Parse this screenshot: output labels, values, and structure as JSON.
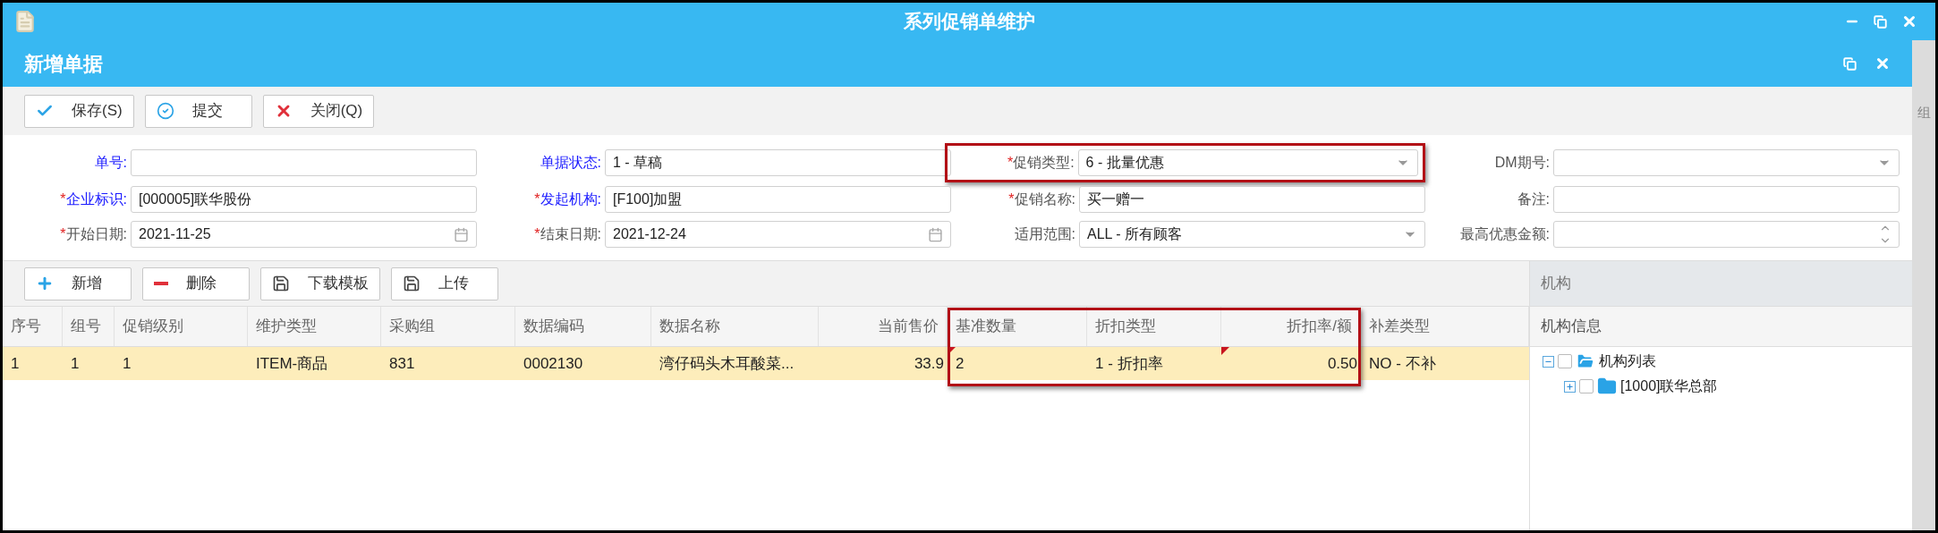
{
  "window": {
    "title": "系列促销单维护"
  },
  "subwindow": {
    "title": "新增单据"
  },
  "toolbar": [
    {
      "label": "保存(S)",
      "kind": "save"
    },
    {
      "label": "提交",
      "kind": "submit"
    },
    {
      "label": "关闭(Q)",
      "kind": "close"
    }
  ],
  "form": [
    {
      "label": "单号:",
      "required": false,
      "color": "#1a1aff",
      "kind": "text",
      "highlighted": false
    },
    {
      "label": "单据状态:",
      "required": false,
      "color": "#1a1aff",
      "value": "1 - 草稿",
      "kind": "text",
      "highlighted": false
    },
    {
      "label": "促销类型:",
      "required": true,
      "color": "#555555",
      "value": "6 - 批量优惠",
      "kind": "select",
      "highlighted": true
    },
    {
      "label": "DM期号:",
      "required": false,
      "color": "#555555",
      "kind": "select",
      "highlighted": false
    },
    {
      "label": "企业标识:",
      "required": true,
      "color": "#1a1aff",
      "value": "[000005]联华股份",
      "kind": "text",
      "highlighted": false
    },
    {
      "label": "发起机构:",
      "required": true,
      "color": "#1a1aff",
      "value": "[F100]加盟",
      "kind": "text",
      "highlighted": false
    },
    {
      "label": "促销名称:",
      "required": true,
      "color": "#555555",
      "value": "买一赠一",
      "kind": "text",
      "highlighted": false
    },
    {
      "label": "备注:",
      "required": false,
      "color": "#555555",
      "kind": "text",
      "highlighted": false
    },
    {
      "label": "开始日期:",
      "required": true,
      "color": "#555555",
      "value": "2021-11-25",
      "kind": "date",
      "highlighted": false
    },
    {
      "label": "结束日期:",
      "required": true,
      "color": "#555555",
      "value": "2021-12-24",
      "kind": "date",
      "highlighted": false
    },
    {
      "label": "适用范围:",
      "required": false,
      "color": "#555555",
      "value": "ALL - 所有顾客",
      "kind": "select",
      "highlighted": false
    },
    {
      "label": "最高优惠金额:",
      "required": false,
      "color": "#555555",
      "kind": "spinner",
      "highlighted": false
    }
  ],
  "required_mark": "*",
  "grid_toolbar": [
    {
      "label": "新增",
      "kind": "add"
    },
    {
      "label": "删除",
      "kind": "delete"
    },
    {
      "label": "下载模板",
      "kind": "save"
    },
    {
      "label": "上传",
      "kind": "save"
    }
  ],
  "table": {
    "columns": [
      {
        "label": "序号",
        "kind": "text",
        "highlighted": false
      },
      {
        "label": "组号",
        "kind": "text",
        "highlighted": false
      },
      {
        "label": "促销级别",
        "kind": "text",
        "highlighted": false
      },
      {
        "label": "维护类型",
        "kind": "text",
        "highlighted": false
      },
      {
        "label": "采购组",
        "kind": "text",
        "highlighted": false
      },
      {
        "label": "数据编码",
        "kind": "text",
        "highlighted": false
      },
      {
        "label": "数据名称",
        "kind": "text",
        "highlighted": false
      },
      {
        "label": "当前售价",
        "kind": "number",
        "highlighted": false
      },
      {
        "label": "基准数量",
        "kind": "text",
        "highlighted": true
      },
      {
        "label": "折扣类型",
        "kind": "text",
        "highlighted": true
      },
      {
        "label": "折扣率/额",
        "kind": "number",
        "highlighted": true
      },
      {
        "label": "补差类型",
        "kind": "text",
        "highlighted": false
      }
    ],
    "rows": [
      {
        "selected": true,
        "cells": [
          {
            "text": "1",
            "edited": false
          },
          {
            "text": "1",
            "edited": false
          },
          {
            "text": "1",
            "edited": false
          },
          {
            "text": "ITEM-商品",
            "edited": false
          },
          {
            "text": "831",
            "edited": false
          },
          {
            "text": "0002130",
            "edited": false
          },
          {
            "text": "湾仔码头木耳酸菜...",
            "edited": false
          },
          {
            "text": "33.9",
            "edited": false
          },
          {
            "text": "2",
            "edited": true
          },
          {
            "text": "1 - 折扣率",
            "edited": false
          },
          {
            "text": "0.50",
            "edited": true
          },
          {
            "text": "NO - 不补",
            "edited": false
          }
        ]
      }
    ]
  },
  "org_panel": {
    "title": "机构",
    "subtitle": "机构信息",
    "tree": [
      {
        "label": "机构列表",
        "expanded": true,
        "checked": false,
        "children": [
          {
            "label": "[1000]联华总部",
            "expanded": false,
            "checked": false
          }
        ]
      }
    ]
  },
  "background_window": {
    "text": "组"
  }
}
